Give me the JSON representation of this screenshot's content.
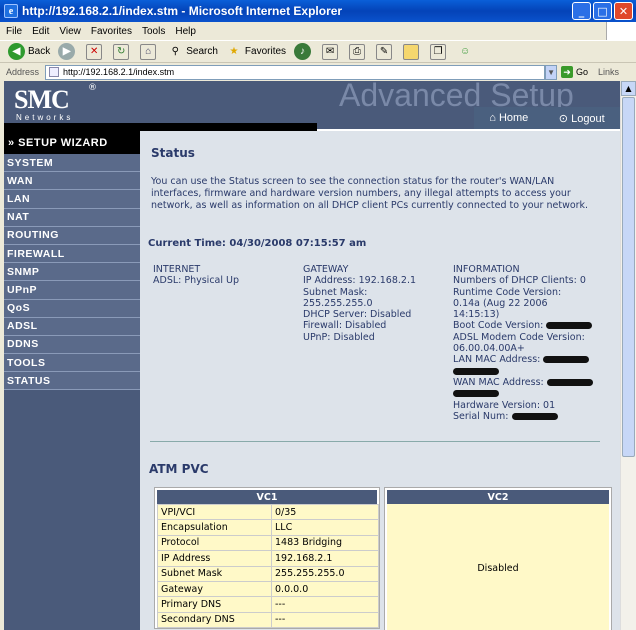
{
  "window": {
    "title": "http://192.168.2.1/index.stm - Microsoft Internet Explorer",
    "minimize": "_",
    "maximize": "□",
    "close": "✕"
  },
  "menu": [
    "File",
    "Edit",
    "View",
    "Favorites",
    "Tools",
    "Help"
  ],
  "toolbar": {
    "back": "Back",
    "search": "Search",
    "favorites": "Favorites"
  },
  "address": {
    "label": "Address",
    "url": "http://192.168.2.1/index.stm",
    "go": "Go",
    "links": "Links"
  },
  "header": {
    "logo": "SMC",
    "logo_sub": "Networks",
    "registered": "®",
    "advanced": "Advanced Setup",
    "home": "Home",
    "logout": "Logout"
  },
  "sidebar": {
    "wizard": "» SETUP WIZARD",
    "items": [
      "SYSTEM",
      "WAN",
      "LAN",
      "NAT",
      "ROUTING",
      "FIREWALL",
      "SNMP",
      "UPnP",
      "QoS",
      "ADSL",
      "DDNS",
      "TOOLS",
      "STATUS"
    ]
  },
  "status": {
    "title": "Status",
    "intro": "You can use the Status screen to see the connection status for the router's WAN/LAN interfaces, firmware and hardware version numbers, any illegal attempts to access your network, as well as information on all DHCP client PCs currently connected to your network.",
    "current_time": "Current Time: 04/30/2008 07:15:57 am",
    "internet": {
      "head": "INTERNET",
      "line1": "ADSL:   Physical Up"
    },
    "gateway": {
      "head": "GATEWAY",
      "lines": [
        "IP Address:  192.168.2.1",
        "Subnet Mask:",
        " 255.255.255.0",
        "DHCP Server:  Disabled",
        "Firewall:  Disabled",
        "UPnP:  Disabled"
      ]
    },
    "information": {
      "head": "INFORMATION",
      "dhcp_clients": "Numbers of DHCP Clients:  0",
      "runtime_label": "Runtime Code Version:",
      "runtime_value": " 0.14a (Aug 22 2006",
      "runtime_value2": " 14:15:13)",
      "boot_label": "Boot Code Version:",
      "modem_label": "ADSL Modem Code Version:",
      "modem_value": "06.00.04.00A+",
      "lan_mac_label": "LAN MAC Address:",
      "wan_mac_label": "WAN MAC Address:",
      "hardware": "Hardware Version:  01",
      "serial_label": "Serial Num:"
    },
    "atm_title": "ATM PVC",
    "vc1": {
      "title": "VC1",
      "rows": [
        [
          "VPI/VCI",
          "0/35"
        ],
        [
          "Encapsulation",
          "LLC"
        ],
        [
          "Protocol",
          "1483 Bridging"
        ],
        [
          "IP Address",
          "192.168.2.1"
        ],
        [
          "Subnet Mask",
          "255.255.255.0"
        ],
        [
          "Gateway",
          "0.0.0.0"
        ],
        [
          "Primary DNS",
          "---"
        ],
        [
          "Secondary DNS",
          "---"
        ]
      ]
    },
    "vc2": {
      "title": "VC2",
      "state": "Disabled"
    }
  }
}
